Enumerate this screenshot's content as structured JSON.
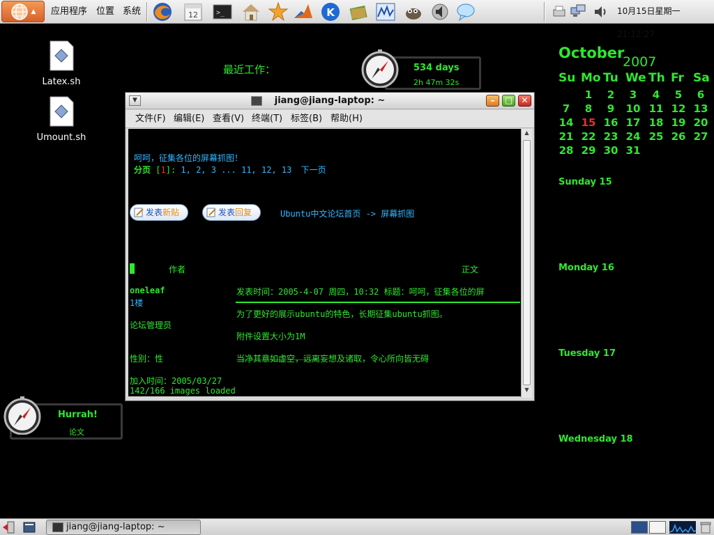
{
  "top_panel": {
    "menu_applications": "应用程序",
    "menu_places": "位置",
    "menu_system": "系统",
    "launchers": [
      "firefox-icon",
      "evolution-calendar-icon",
      "terminal-icon",
      "home-folder-icon",
      "starburst-icon",
      "matlab-icon",
      "kde-icon",
      "books-icon",
      "system-monitor-icon",
      "gimp-icon",
      "sound-settings-icon",
      "chat-bubble-icon"
    ],
    "clock": "10月15日星期一 21:12:27"
  },
  "desktop_icons": [
    {
      "label": "Latex.sh"
    },
    {
      "label": "Umount.sh"
    }
  ],
  "recent_work_label": "最近工作：",
  "uptime": {
    "days": "534 days",
    "time": "2h 47m 32s"
  },
  "hurrah": {
    "title": "Hurrah!",
    "subtitle": "论文"
  },
  "calendar": {
    "month": "October",
    "year": "2007",
    "weekdays": [
      "Su",
      "Mo",
      "Tu",
      "We",
      "Th",
      "Fr",
      "Sa"
    ],
    "today": "15",
    "rows": [
      [
        "",
        "1",
        "2",
        "3",
        "4",
        "5",
        "6"
      ],
      [
        "7",
        "8",
        "9",
        "10",
        "11",
        "12",
        "13"
      ],
      [
        "14",
        "15",
        "16",
        "17",
        "18",
        "19",
        "20"
      ],
      [
        "21",
        "22",
        "23",
        "24",
        "25",
        "26",
        "27"
      ],
      [
        "28",
        "29",
        "30",
        "31",
        "",
        "",
        ""
      ]
    ],
    "agenda": [
      "Sunday 15",
      "Monday 16",
      "Tuesday 17",
      "Wednesday 18"
    ]
  },
  "terminal": {
    "title": "jiang@jiang-laptop: ~",
    "menus": [
      "文件(F)",
      "编辑(E)",
      "查看(V)",
      "终端(T)",
      "标签(B)",
      "帮助(H)"
    ],
    "line_topic": "呵呵，征集各位的屏幕抓图！",
    "page_label": "分页",
    "page_open": "[",
    "page_current": "1",
    "page_close": "]:",
    "page_links": "1, 2, 3 ... 11, 12, 13",
    "next_page": "下一页",
    "btn_new_post": {
      "a": "发表",
      "b": "新贴"
    },
    "btn_reply": {
      "a": "发表",
      "b": "回复"
    },
    "breadcrumb": "Ubuntu中文论坛首页 -> 屏幕抓图",
    "col_author": "作者",
    "col_body": "正文",
    "post_author": "oneleaf",
    "post_floor": "1楼",
    "post_meta": "发表时间：2005-4-07 周四，10:32   标题：呵呵，征集各位的屏",
    "post_line1": "为了更好的展示ubuntu的特色，长期征集ubuntu抓图。",
    "author_role": "论坛管理员",
    "post_line2": "附件设置大小为1M",
    "author_gender": "性别：性",
    "post_signature": "当净其意如虚空，远离妄想及诸取，令心所向皆无碍",
    "author_joined": "加入时间：2005/03/27",
    "status": "142/166 images loaded"
  },
  "bottom_panel": {
    "taskbar_item": "jiang@jiang-laptop: ~"
  }
}
